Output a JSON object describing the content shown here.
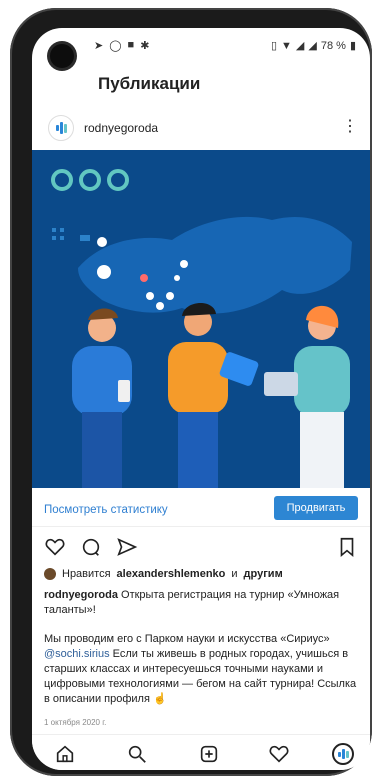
{
  "status": {
    "battery": "78 %"
  },
  "header": {
    "title": "Публикации"
  },
  "post": {
    "account": "rodnyegoroda",
    "stats_link": "Посмотреть статистику",
    "promote_button": "Продвигать",
    "likes": {
      "prefix": "Нравится",
      "user": "alexandershlemenko",
      "connector": "и",
      "suffix": "другим"
    },
    "caption_user": "rodnyegoroda",
    "caption_line1": "Открыта регистрация на турнир «Умножая таланты»!",
    "caption_line2": "Мы проводим его с Парком науки и искусства «Сириус»",
    "mention": "@sochi.sirius",
    "caption_line3": "Если ты живешь в родных городах, учишься в старших классах и интересуешься точными науками и цифровыми технологиями — бегом на сайт турнира! Ссылка в описании профиля",
    "emoji": "☝️",
    "date": "1 октября 2020 г."
  },
  "icons": {
    "like": "heart-icon",
    "comment": "comment-icon",
    "share": "send-icon",
    "save": "bookmark-icon",
    "home": "home-icon",
    "search": "search-icon",
    "add": "add-post-icon",
    "activity": "heart-icon",
    "profile": "profile-avatar-icon",
    "more": "more-vertical-icon"
  },
  "colors": {
    "accent": "#2d86d3",
    "image_bg": "#0b4a8a",
    "map": "#1766b4"
  }
}
